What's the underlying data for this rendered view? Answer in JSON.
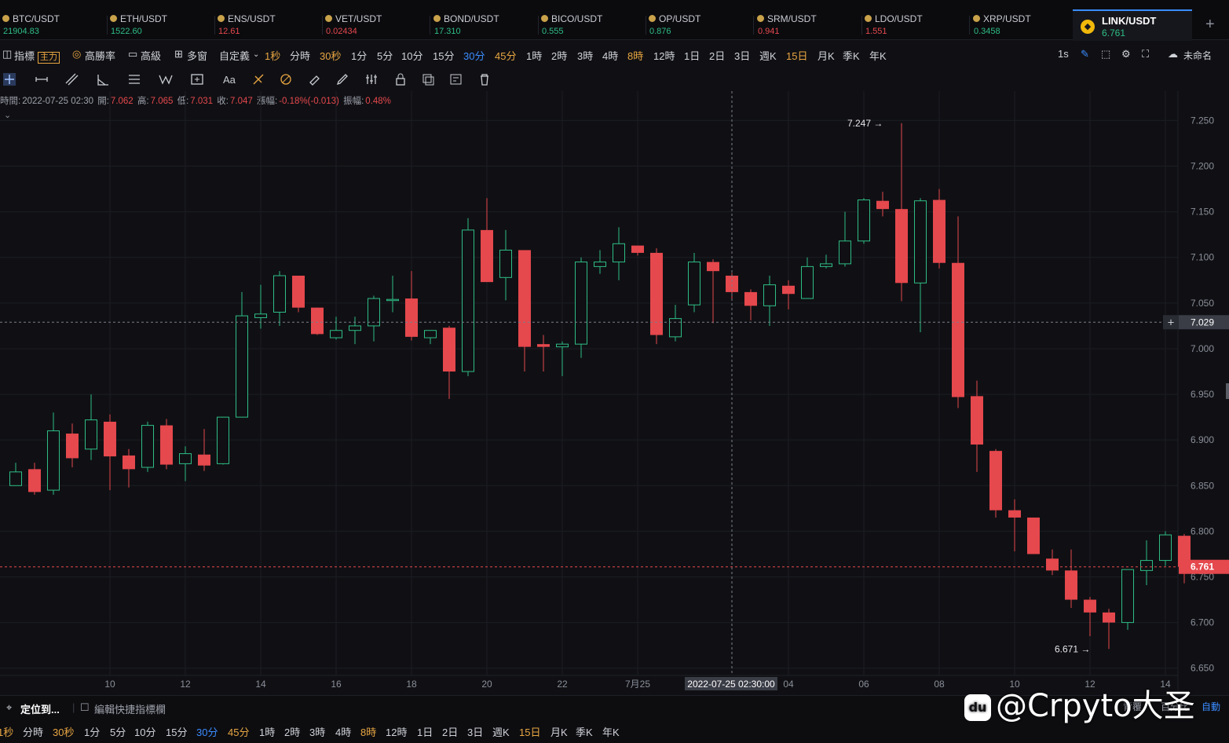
{
  "tickers": [
    {
      "symbol": "BTC/USDT",
      "price": "21904.83",
      "trend": "up"
    },
    {
      "symbol": "ETH/USDT",
      "price": "1522.60",
      "trend": "up"
    },
    {
      "symbol": "ENS/USDT",
      "price": "12.61",
      "trend": "down"
    },
    {
      "symbol": "VET/USDT",
      "price": "0.02434",
      "trend": "down"
    },
    {
      "symbol": "BOND/USDT",
      "price": "17.310",
      "trend": "up"
    },
    {
      "symbol": "BICO/USDT",
      "price": "0.555",
      "trend": "up"
    },
    {
      "symbol": "OP/USDT",
      "price": "0.876",
      "trend": "up"
    },
    {
      "symbol": "SRM/USDT",
      "price": "0.941",
      "trend": "down"
    },
    {
      "symbol": "LDO/USDT",
      "price": "1.551",
      "trend": "down"
    },
    {
      "symbol": "XRP/USDT",
      "price": "0.3458",
      "trend": "up"
    }
  ],
  "active_ticker": {
    "symbol": "LINK/USDT",
    "price": "6.761",
    "icon": "binance-logo-icon"
  },
  "toolbar": {
    "indicators_label": "指標",
    "main_badge": "主力",
    "win_rate_label": "高勝率",
    "advanced_label": "高級",
    "multi_window_label": "多窗",
    "custom_label": "自定義",
    "intervals": [
      "1秒",
      "分時",
      "30秒",
      "1分",
      "5分",
      "10分",
      "15分",
      "30分",
      "45分",
      "1時",
      "2時",
      "3時",
      "4時",
      "8時",
      "12時",
      "1日",
      "2日",
      "3日",
      "週K",
      "15日",
      "月K",
      "季K",
      "年K"
    ],
    "active_interval": "30分",
    "refresh_label": "1s",
    "layout_name": "未命名"
  },
  "info_line": {
    "time_label": "時間:",
    "time": "2022-07-25 02:30",
    "open_label": "開:",
    "open": "7.062",
    "high_label": "高:",
    "high": "7.065",
    "low_label": "低:",
    "low": "7.031",
    "close_label": "收:",
    "close": "7.047",
    "change_label": "漲幅:",
    "change": "-0.18%(-0.013)",
    "amplitude_label": "振幅:",
    "amplitude": "0.48%"
  },
  "chart_data": {
    "type": "candlestick",
    "y_ticks": [
      "7.250",
      "7.200",
      "7.150",
      "7.100",
      "7.050",
      "7.000",
      "6.950",
      "6.900",
      "6.850",
      "6.800",
      "6.750",
      "6.700",
      "6.650"
    ],
    "ylim": [
      6.642,
      7.265
    ],
    "x_ticks": [
      "10",
      "12",
      "14",
      "16",
      "18",
      "20",
      "22",
      "7月25",
      "04",
      "06",
      "08",
      "10",
      "12",
      "14"
    ],
    "crosshair": {
      "time_label": "2022-07-25 02:30:00",
      "price_label": "7.029",
      "price": 7.029
    },
    "last_price": {
      "label": "6.761",
      "value": 6.761
    },
    "max_marker": {
      "label": "7.247",
      "value": 7.247
    },
    "min_marker": {
      "label": "6.671",
      "value": 6.671
    },
    "candles": [
      {
        "o": 6.85,
        "h": 6.875,
        "l": 6.855,
        "c": 6.865
      },
      {
        "o": 6.868,
        "h": 6.875,
        "l": 6.84,
        "c": 6.843
      },
      {
        "o": 6.845,
        "h": 6.93,
        "l": 6.84,
        "c": 6.91
      },
      {
        "o": 6.907,
        "h": 6.918,
        "l": 6.87,
        "c": 6.88
      },
      {
        "o": 6.89,
        "h": 6.95,
        "l": 6.878,
        "c": 6.922
      },
      {
        "o": 6.92,
        "h": 6.928,
        "l": 6.845,
        "c": 6.882
      },
      {
        "o": 6.883,
        "h": 6.89,
        "l": 6.848,
        "c": 6.868
      },
      {
        "o": 6.87,
        "h": 6.92,
        "l": 6.865,
        "c": 6.916
      },
      {
        "o": 6.916,
        "h": 6.923,
        "l": 6.868,
        "c": 6.873
      },
      {
        "o": 6.874,
        "h": 6.893,
        "l": 6.855,
        "c": 6.885
      },
      {
        "o": 6.884,
        "h": 6.912,
        "l": 6.866,
        "c": 6.872
      },
      {
        "o": 6.874,
        "h": 6.925,
        "l": 6.873,
        "c": 6.925
      },
      {
        "o": 6.925,
        "h": 7.062,
        "l": 6.925,
        "c": 7.036
      },
      {
        "o": 7.034,
        "h": 7.07,
        "l": 7.022,
        "c": 7.038
      },
      {
        "o": 7.04,
        "h": 7.085,
        "l": 7.025,
        "c": 7.08
      },
      {
        "o": 7.08,
        "h": 7.08,
        "l": 7.04,
        "c": 7.045
      },
      {
        "o": 7.045,
        "h": 7.045,
        "l": 7.015,
        "c": 7.016
      },
      {
        "o": 7.012,
        "h": 7.035,
        "l": 7.01,
        "c": 7.02
      },
      {
        "o": 7.02,
        "h": 7.035,
        "l": 7.005,
        "c": 7.025
      },
      {
        "o": 7.025,
        "h": 7.058,
        "l": 7.008,
        "c": 7.055
      },
      {
        "o": 7.054,
        "h": 7.08,
        "l": 7.04,
        "c": 7.054
      },
      {
        "o": 7.055,
        "h": 7.085,
        "l": 7.009,
        "c": 7.013
      },
      {
        "o": 7.012,
        "h": 7.02,
        "l": 7.005,
        "c": 7.02
      },
      {
        "o": 7.023,
        "h": 7.025,
        "l": 6.945,
        "c": 6.975
      },
      {
        "o": 6.975,
        "h": 7.143,
        "l": 6.97,
        "c": 7.13
      },
      {
        "o": 7.13,
        "h": 7.165,
        "l": 7.075,
        "c": 7.073
      },
      {
        "o": 7.078,
        "h": 7.13,
        "l": 7.053,
        "c": 7.108
      },
      {
        "o": 7.108,
        "h": 7.108,
        "l": 6.975,
        "c": 7.002
      },
      {
        "o": 7.005,
        "h": 7.015,
        "l": 6.975,
        "c": 7.002
      },
      {
        "o": 7.002,
        "h": 7.008,
        "l": 6.97,
        "c": 7.005
      },
      {
        "o": 7.005,
        "h": 7.1,
        "l": 6.99,
        "c": 7.095
      },
      {
        "o": 7.09,
        "h": 7.108,
        "l": 7.082,
        "c": 7.095
      },
      {
        "o": 7.095,
        "h": 7.133,
        "l": 7.075,
        "c": 7.115
      },
      {
        "o": 7.113,
        "h": 7.113,
        "l": 7.102,
        "c": 7.105
      },
      {
        "o": 7.105,
        "h": 7.11,
        "l": 7.005,
        "c": 7.015
      },
      {
        "o": 7.013,
        "h": 7.048,
        "l": 7.008,
        "c": 7.033
      },
      {
        "o": 7.048,
        "h": 7.105,
        "l": 7.04,
        "c": 7.095
      },
      {
        "o": 7.095,
        "h": 7.098,
        "l": 7.028,
        "c": 7.085
      },
      {
        "o": 7.08,
        "h": 7.083,
        "l": 7.053,
        "c": 7.062
      },
      {
        "o": 7.062,
        "h": 7.065,
        "l": 7.031,
        "c": 7.047
      },
      {
        "o": 7.047,
        "h": 7.08,
        "l": 7.025,
        "c": 7.07
      },
      {
        "o": 7.069,
        "h": 7.075,
        "l": 7.043,
        "c": 7.06
      },
      {
        "o": 7.055,
        "h": 7.1,
        "l": 7.055,
        "c": 7.09
      },
      {
        "o": 7.09,
        "h": 7.103,
        "l": 7.088,
        "c": 7.093
      },
      {
        "o": 7.093,
        "h": 7.15,
        "l": 7.09,
        "c": 7.118
      },
      {
        "o": 7.118,
        "h": 7.165,
        "l": 7.115,
        "c": 7.163
      },
      {
        "o": 7.162,
        "h": 7.172,
        "l": 7.145,
        "c": 7.153
      },
      {
        "o": 7.153,
        "h": 7.247,
        "l": 7.052,
        "c": 7.072
      },
      {
        "o": 7.072,
        "h": 7.165,
        "l": 7.018,
        "c": 7.162
      },
      {
        "o": 7.163,
        "h": 7.175,
        "l": 7.088,
        "c": 7.094
      },
      {
        "o": 7.094,
        "h": 7.145,
        "l": 6.935,
        "c": 6.947
      },
      {
        "o": 6.948,
        "h": 6.965,
        "l": 6.865,
        "c": 6.895
      },
      {
        "o": 6.888,
        "h": 6.89,
        "l": 6.815,
        "c": 6.823
      },
      {
        "o": 6.823,
        "h": 6.835,
        "l": 6.778,
        "c": 6.815
      },
      {
        "o": 6.815,
        "h": 6.815,
        "l": 6.778,
        "c": 6.775
      },
      {
        "o": 6.77,
        "h": 6.78,
        "l": 6.752,
        "c": 6.757
      },
      {
        "o": 6.757,
        "h": 6.78,
        "l": 6.716,
        "c": 6.725
      },
      {
        "o": 6.725,
        "h": 6.728,
        "l": 6.685,
        "c": 6.711
      },
      {
        "o": 6.711,
        "h": 6.715,
        "l": 6.671,
        "c": 6.7
      },
      {
        "o": 6.7,
        "h": 6.758,
        "l": 6.692,
        "c": 6.758
      },
      {
        "o": 6.757,
        "h": 6.79,
        "l": 6.741,
        "c": 6.768
      },
      {
        "o": 6.768,
        "h": 6.8,
        "l": 6.762,
        "c": 6.796
      },
      {
        "o": 6.795,
        "h": 6.797,
        "l": 6.743,
        "c": 6.761
      }
    ]
  },
  "bottom": {
    "locate_label": "定位到...",
    "edit_label": "編輯快捷指標欄",
    "intervals": [
      "1秒",
      "分時",
      "30秒",
      "1分",
      "5分",
      "10分",
      "15分",
      "30分",
      "45分",
      "1時",
      "2時",
      "3時",
      "4時",
      "8時",
      "12時",
      "1日",
      "2日",
      "3日",
      "週K",
      "15日",
      "月K",
      "季K",
      "年K"
    ],
    "right_labels": [
      "背覆",
      "百分比",
      "自動"
    ]
  },
  "watermark": {
    "badge": "du",
    "text": "@Crpyto大圣"
  },
  "colors": {
    "up": "#2ebd85",
    "down": "#e5484d",
    "accent": "#3b8cff",
    "orange": "#e8a642"
  }
}
